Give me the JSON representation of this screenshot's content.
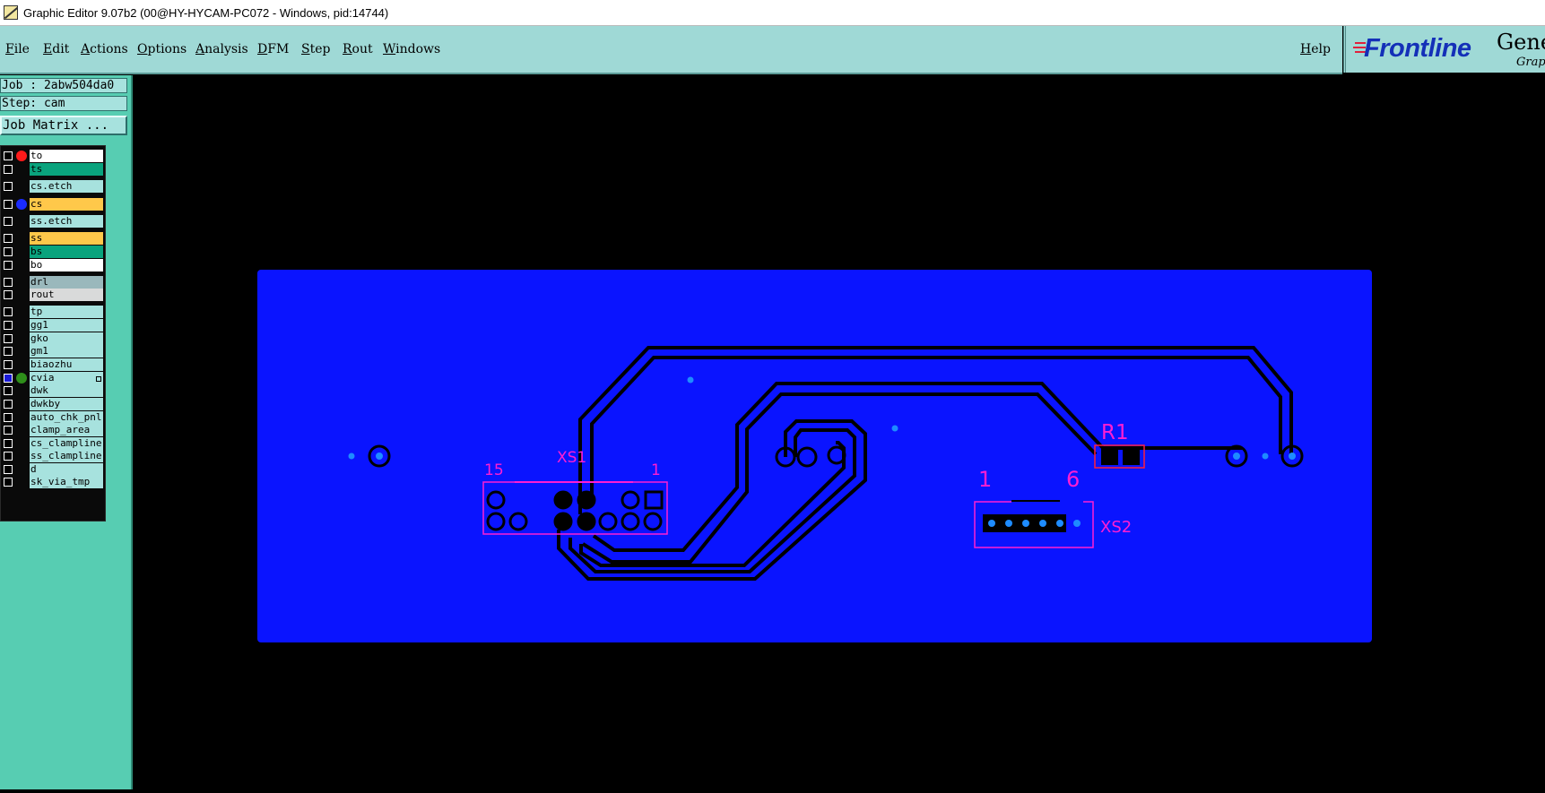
{
  "window": {
    "title": "Graphic Editor 9.07b2 (00@HY-HYCAM-PC072 - Windows, pid:14744)",
    "app_icon": "editor-app-icon"
  },
  "menubar": {
    "items": [
      {
        "first": "F",
        "rest": "ile"
      },
      {
        "first": "E",
        "rest": "dit"
      },
      {
        "first": "A",
        "rest": "ctions"
      },
      {
        "first": "O",
        "rest": "ptions"
      },
      {
        "first": "A",
        "rest": "nalysis"
      },
      {
        "first": "D",
        "rest": "FM"
      },
      {
        "first": "S",
        "rest": "tep"
      },
      {
        "first": "R",
        "rest": "out"
      },
      {
        "first": "W",
        "rest": "indows"
      }
    ],
    "help": {
      "first": "H",
      "rest": "elp"
    },
    "logo": {
      "word": "Frontline",
      "gene": "Gene",
      "grap": "Grap",
      "color": "#1430b8",
      "accent": "#e0203c"
    }
  },
  "info": {
    "job": "Job : 2abw504da0",
    "step": "Step: cam",
    "job_matrix": "Job Matrix ..."
  },
  "layers": [
    {
      "name": "to",
      "bg": "#ffffff",
      "dot": "#ff1a1a",
      "checked": false
    },
    {
      "name": "ts",
      "bg": "#0aa37d",
      "checked": false
    },
    {
      "name": "cs.etch",
      "bg": "#a7e2de",
      "checked": false
    },
    {
      "name": "cs",
      "bg": "#ffc84a",
      "dot": "#1a2bff",
      "checked": false
    },
    {
      "name": "ss.etch",
      "bg": "#a7e2de",
      "checked": false
    },
    {
      "name": "ss",
      "bg": "#ffc84a",
      "checked": false
    },
    {
      "name": "bs",
      "bg": "#0aa37d",
      "checked": false
    },
    {
      "name": "bo",
      "bg": "#ffffff",
      "checked": false
    },
    {
      "name": "drl",
      "bg": "#9ab8bc",
      "checked": false
    },
    {
      "name": "rout",
      "bg": "#d9dada",
      "checked": false
    },
    {
      "name": "tp",
      "bg": "#a7e2de",
      "checked": false
    },
    {
      "name": "gg1",
      "bg": "#a7e2de",
      "checked": false
    },
    {
      "name": "gko",
      "bg": "#a7e2de",
      "checked": false
    },
    {
      "name": "gm1",
      "bg": "#a7e2de",
      "checked": false
    },
    {
      "name": "biaozhu",
      "bg": "#a7e2de",
      "checked": false
    },
    {
      "name": "cvia",
      "bg": "#a7e2de",
      "dot": "#2e8f1a",
      "checked": true
    },
    {
      "name": "dwk",
      "bg": "#a7e2de",
      "checked": false
    },
    {
      "name": "dwkby",
      "bg": "#a7e2de",
      "checked": false
    },
    {
      "name": "auto_chk_pnl",
      "bg": "#a7e2de",
      "checked": false
    },
    {
      "name": "clamp_area",
      "bg": "#a7e2de",
      "checked": false
    },
    {
      "name": "cs_clampline",
      "bg": "#a7e2de",
      "checked": false
    },
    {
      "name": "ss_clampline",
      "bg": "#a7e2de",
      "checked": false
    },
    {
      "name": "d",
      "bg": "#a7e2de",
      "checked": false
    },
    {
      "name": "sk_via_tmp",
      "bg": "#a7e2de",
      "checked": false
    }
  ],
  "pcb": {
    "labels": {
      "xs1_pin15": "15",
      "xs1_name": "XS1",
      "xs1_pin1": "1",
      "r1_name": "R1",
      "xs2_pin1": "1",
      "xs2_pin6": "6",
      "xs2_name": "XS2"
    },
    "colors": {
      "board": "#0a14ff",
      "silk": "#ff1ed2",
      "pad": "#1e8cff",
      "trace": "#000000"
    }
  }
}
